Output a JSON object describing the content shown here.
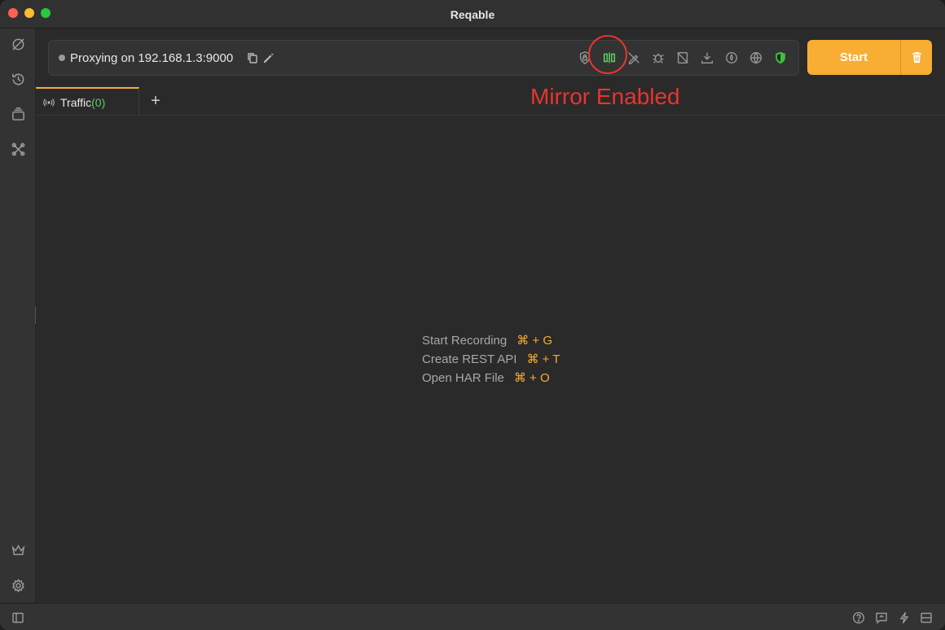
{
  "window": {
    "title": "Reqable"
  },
  "sidebar": {
    "items": [
      {
        "icon": "compass-icon"
      },
      {
        "icon": "history-icon"
      },
      {
        "icon": "collections-icon"
      },
      {
        "icon": "tools-icon"
      }
    ],
    "bottom": [
      {
        "icon": "crown-icon"
      },
      {
        "icon": "gear-icon"
      }
    ]
  },
  "proxy": {
    "status_text": "Proxying on 192.168.1.3:9000",
    "toolbar_icons": [
      "ssl-lock-icon",
      "mirror-icon",
      "rewrite-icon",
      "breakpoint-icon",
      "block-icon",
      "download-icon",
      "gateway-icon",
      "network-icon",
      "shield-icon"
    ]
  },
  "actions": {
    "start_label": "Start"
  },
  "tabs": [
    {
      "label": "Traffic",
      "count": "(0)"
    }
  ],
  "annotation": {
    "text": "Mirror Enabled"
  },
  "shortcuts": [
    {
      "label": "Start Recording",
      "key": "⌘ + G"
    },
    {
      "label": "Create REST API",
      "key": "⌘ + T"
    },
    {
      "label": "Open HAR File",
      "key": "⌘ + O"
    }
  ],
  "colors": {
    "accent": "#f8ad33",
    "active_green": "#5cd05c",
    "annotation_red": "#e8352e"
  }
}
